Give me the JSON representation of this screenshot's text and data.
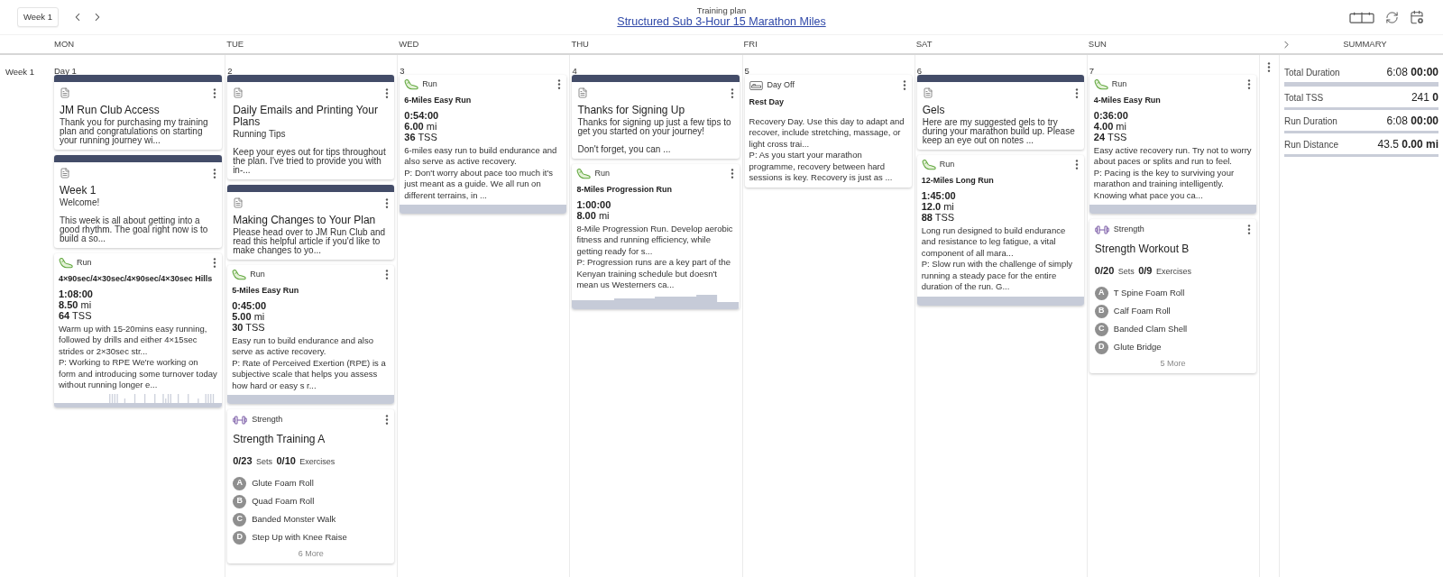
{
  "toolbar": {
    "week_button": "Week 1"
  },
  "plan": {
    "caption": "Training plan",
    "title": "Structured Sub 3-Hour 15 Marathon Miles"
  },
  "day_headers": [
    "MON",
    "TUE",
    "WED",
    "THU",
    "FRI",
    "SAT",
    "SUN"
  ],
  "summary_header": "SUMMARY",
  "week": {
    "label": "Week 1",
    "days": [
      {
        "date": "Day 1",
        "cards": [
          {
            "kind": "note",
            "title": "JM Run Club Access",
            "paragraphs": [
              "Thank you for purchasing my training plan and congratulations on starting your running journey wi..."
            ]
          },
          {
            "kind": "note",
            "title": "Week 1",
            "paragraphs": [
              "Welcome!",
              "This week is all about getting into a good rhythm. The goal right now is to build a so..."
            ]
          },
          {
            "kind": "run",
            "type": "Run",
            "title": "4×90sec/4×30sec/4×90sec/4×30sec Hills",
            "duration": "1:08:00",
            "distance": "8.50",
            "distance_unit": "mi",
            "tss": "64",
            "tss_unit": "TSS",
            "text": "Warm up with 15-20mins easy running, followed by drills and either 4×15sec strides or 2×30sec str...",
            "note": "P: Working to RPE We're working on form and introducing some turnover today without running longer e...",
            "graph": {
              "kind": "intervals"
            }
          }
        ]
      },
      {
        "date": "2",
        "cards": [
          {
            "kind": "note",
            "title": "Daily Emails and Printing Your Plans",
            "paragraphs": [
              "Running Tips",
              "Keep your eyes out for tips throughout the plan. I've tried to provide you with in-..."
            ]
          },
          {
            "kind": "note",
            "title": "Making Changes to Your Plan",
            "paragraphs": [
              "Please head over to JM Run Club and read this helpful article if you'd like to make changes to yo..."
            ]
          },
          {
            "kind": "run",
            "type": "Run",
            "title": "5-Miles Easy Run",
            "duration": "0:45:00",
            "distance": "5.00",
            "distance_unit": "mi",
            "tss": "30",
            "tss_unit": "TSS",
            "text": "Easy run to build endurance and also serve as active recovery.",
            "note": "P: Rate of Perceived Exertion (RPE) is a subjective scale that helps you assess how hard or easy s r...",
            "graph": {
              "kind": "flat"
            }
          },
          {
            "kind": "strength",
            "type": "Strength",
            "title": "Strength Training A",
            "sets": "0/23",
            "sets_label": "Sets",
            "exercises": "0/10",
            "exercises_label": "Exercises",
            "items": [
              {
                "letter": "A",
                "name": "Glute Foam Roll"
              },
              {
                "letter": "B",
                "name": "Quad Foam Roll"
              },
              {
                "letter": "C",
                "name": "Banded Monster Walk"
              },
              {
                "letter": "D",
                "name": "Step Up with Knee Raise"
              }
            ],
            "more": "6 More"
          }
        ]
      },
      {
        "date": "3",
        "cards": [
          {
            "kind": "run",
            "type": "Run",
            "title": "6-Miles Easy Run",
            "duration": "0:54:00",
            "distance": "6.00",
            "distance_unit": "mi",
            "tss": "36",
            "tss_unit": "TSS",
            "text": "6-miles easy run to build endurance and also serve as active recovery.",
            "note": "P: Don't worry about pace too much it's just meant as a guide. We all run on different terrains, in ...",
            "graph": {
              "kind": "flat"
            }
          }
        ]
      },
      {
        "date": "4",
        "cards": [
          {
            "kind": "note",
            "title": "Thanks for Signing Up",
            "paragraphs": [
              "Thanks for signing up just a few tips to get you started on your journey!",
              "Don't forget, you can ..."
            ]
          },
          {
            "kind": "run",
            "type": "Run",
            "title": "8-Miles Progression Run",
            "duration": "1:00:00",
            "distance": "8.00",
            "distance_unit": "mi",
            "text": "8-Mile Progression Run. Develop aerobic fitness and running efficiency, while getting ready for s...",
            "note": "P: Progression runs are a key part of the Kenyan training schedule but doesn't mean us Westerners ca...",
            "graph": {
              "kind": "steps"
            }
          }
        ]
      },
      {
        "date": "5",
        "cards": [
          {
            "kind": "dayoff",
            "type": "Day Off",
            "title": "Rest Day",
            "text": "Recovery Day. Use this day to adapt and recover, include stretching, massage, or light cross trai...",
            "note": "P: As you start your marathon programme, recovery between hard sessions is key. Recovery is just as ..."
          }
        ]
      },
      {
        "date": "6",
        "cards": [
          {
            "kind": "note",
            "title": "Gels",
            "paragraphs": [
              "Here are my suggested gels to try during your marathon build up. Please keep an eye out on notes ..."
            ]
          },
          {
            "kind": "run",
            "type": "Run",
            "title": "12-Miles Long Run",
            "duration": "1:45:00",
            "distance": "12.0",
            "distance_unit": "mi",
            "tss": "88",
            "tss_unit": "TSS",
            "text": "Long run designed to build endurance and resistance to leg fatigue, a vital component of all mara...",
            "note": "P: Slow run with the challenge of simply running a steady pace for the entire duration of the run. G...",
            "graph": {
              "kind": "flat"
            }
          }
        ]
      },
      {
        "date": "7",
        "cards": [
          {
            "kind": "run",
            "type": "Run",
            "title": "4-Miles Easy Run",
            "duration": "0:36:00",
            "distance": "4.00",
            "distance_unit": "mi",
            "tss": "24",
            "tss_unit": "TSS",
            "text": "Easy active recovery run. Try not to worry about paces or splits and run to feel.",
            "note": "P: Pacing is the key to surviving your marathon and training intelligently. Knowing what pace you ca...",
            "graph": {
              "kind": "flat"
            }
          },
          {
            "kind": "strength",
            "type": "Strength",
            "title": "Strength Workout B",
            "sets": "0/20",
            "sets_label": "Sets",
            "exercises": "0/9",
            "exercises_label": "Exercises",
            "items": [
              {
                "letter": "A",
                "name": "T Spine Foam Roll"
              },
              {
                "letter": "B",
                "name": "Calf Foam Roll"
              },
              {
                "letter": "C",
                "name": "Banded Clam Shell"
              },
              {
                "letter": "D",
                "name": "Glute Bridge"
              }
            ],
            "more": "5 More"
          }
        ]
      }
    ]
  },
  "summary": [
    {
      "label": "Total Duration",
      "planned": "6:08",
      "completed": "00:00"
    },
    {
      "label": "Total TSS",
      "planned": "241",
      "completed": "0"
    },
    {
      "label": "Run Duration",
      "planned": "6:08",
      "completed": "00:00"
    },
    {
      "label": "Run Distance",
      "planned": "43.5",
      "completed": "0.00 mi"
    }
  ]
}
